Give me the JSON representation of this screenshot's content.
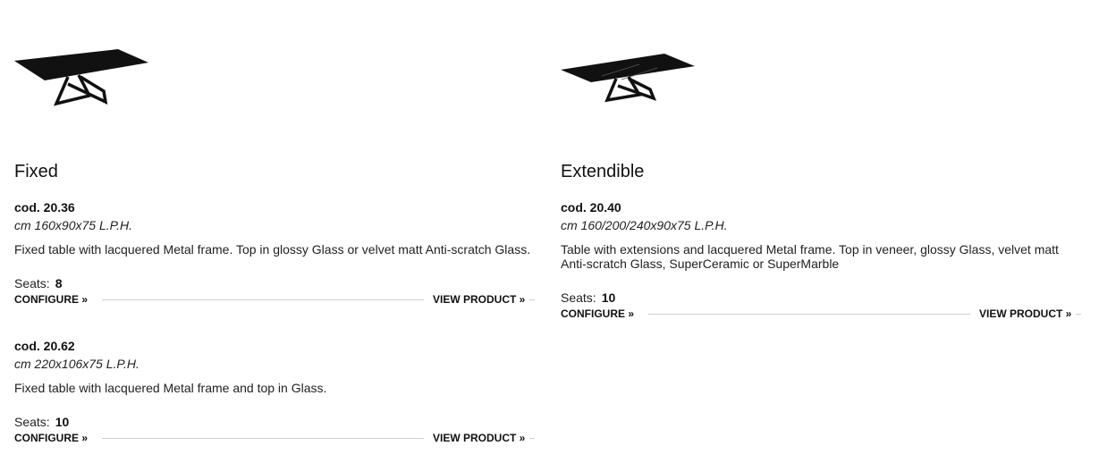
{
  "products": [
    {
      "title": "Fixed",
      "image_icon": "fixed-table-icon",
      "variants": [
        {
          "code": "cod. 20.36",
          "dimensions": "cm 160x90x75 L.P.H.",
          "description": "Fixed table with lacquered Metal frame. Top in glossy Glass or velvet matt Anti-scratch Glass.",
          "seats_label": "Seats:",
          "seats_value": "8",
          "configure_label": "CONFIGURE »",
          "view_label": "VIEW PRODUCT »"
        },
        {
          "code": "cod. 20.62",
          "dimensions": "cm 220x106x75 L.P.H.",
          "description": "Fixed table with lacquered Metal frame and top in Glass.",
          "seats_label": "Seats:",
          "seats_value": "10",
          "configure_label": "CONFIGURE »",
          "view_label": "VIEW PRODUCT »"
        }
      ]
    },
    {
      "title": "Extendible",
      "image_icon": "extendible-table-icon",
      "variants": [
        {
          "code": "cod. 20.40",
          "dimensions": "cm 160/200/240x90x75 L.P.H.",
          "description": "Table with extensions and lacquered Metal frame. Top in veneer, glossy Glass, velvet matt Anti-scratch Glass, SuperCeramic or SuperMarble",
          "seats_label": "Seats:",
          "seats_value": "10",
          "configure_label": "CONFIGURE »",
          "view_label": "VIEW PRODUCT »"
        }
      ]
    }
  ]
}
